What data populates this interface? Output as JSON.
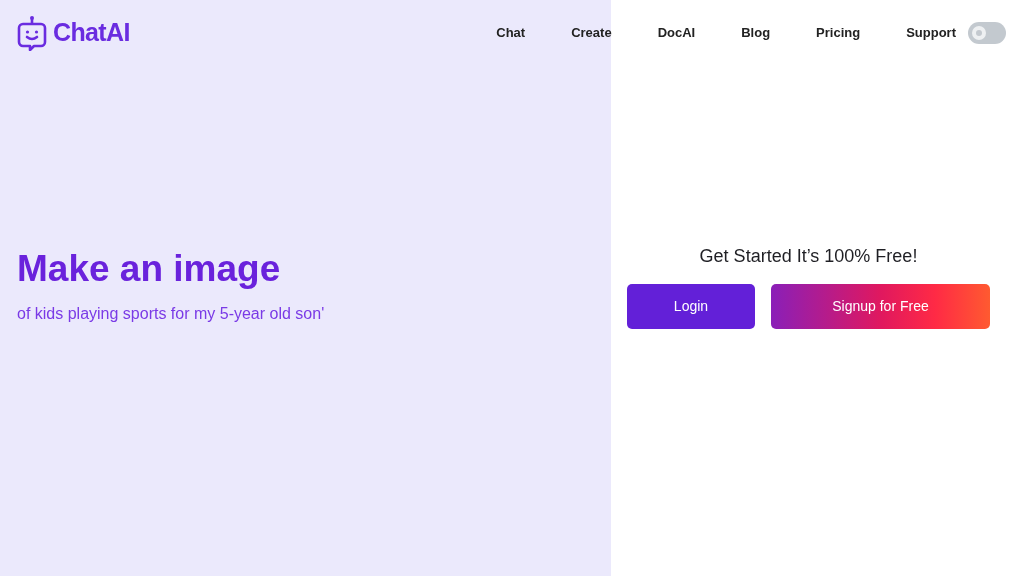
{
  "logo": {
    "text": "ChatAI"
  },
  "nav": [
    "Chat",
    "Create",
    "DocAI",
    "Blog",
    "Pricing",
    "Support"
  ],
  "theme_toggle": {
    "on": false
  },
  "hero": {
    "title": "Make an image",
    "subtitle": "of kids playing sports for my 5-year old son'"
  },
  "signup_panel": {
    "heading": "Get Started It’s 100% Free!",
    "buttons": [
      {
        "label": "Login",
        "kind": "solid"
      },
      {
        "label": "Signup for Free",
        "kind": "gradient"
      }
    ]
  }
}
